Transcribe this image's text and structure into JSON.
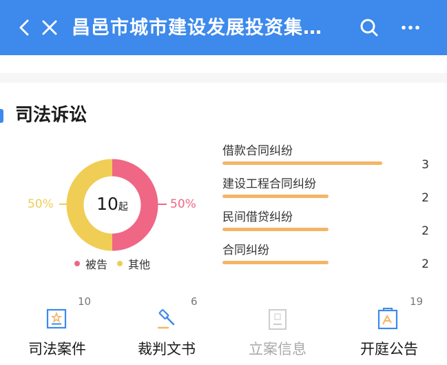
{
  "header": {
    "title": "昌邑市城市建设发展投资集…",
    "back_icon": "chevron-left-icon",
    "close_icon": "close-icon",
    "search_icon": "search-icon",
    "more_icon": "more-icon",
    "bg_color": "#3d89ec"
  },
  "section": {
    "title": "司法诉讼"
  },
  "donut": {
    "total": "10",
    "unit": "起",
    "left_pct": "50%",
    "right_pct": "50%",
    "legend": [
      {
        "label": "被告",
        "color": "#ef6784"
      },
      {
        "label": "其他",
        "color": "#f0cd55"
      }
    ],
    "share": [
      {
        "name": "被告",
        "value": 50,
        "color": "#ef6784"
      },
      {
        "name": "其他",
        "value": 50,
        "color": "#f0cd55"
      }
    ]
  },
  "cases": [
    {
      "label": "借款合同纠纷",
      "count": "3",
      "value": 3
    },
    {
      "label": "建设工程合同纠纷",
      "count": "2",
      "value": 2
    },
    {
      "label": "民间借贷纠纷",
      "count": "2",
      "value": 2
    },
    {
      "label": "合同纠纷",
      "count": "2",
      "value": 2
    }
  ],
  "tabs": [
    {
      "label": "司法案件",
      "count": "10",
      "icon": "judicial-case-icon"
    },
    {
      "label": "裁判文书",
      "count": "6",
      "icon": "gavel-icon"
    },
    {
      "label": "立案信息",
      "count": "",
      "icon": "filing-info-icon"
    },
    {
      "label": "开庭公告",
      "count": "19",
      "icon": "court-notice-icon"
    }
  ],
  "colors": {
    "accent": "#3d89ec",
    "bar": "#f4b567",
    "defendant": "#ef6784",
    "other": "#f0cd55",
    "disabled": "#aaaaaa"
  }
}
